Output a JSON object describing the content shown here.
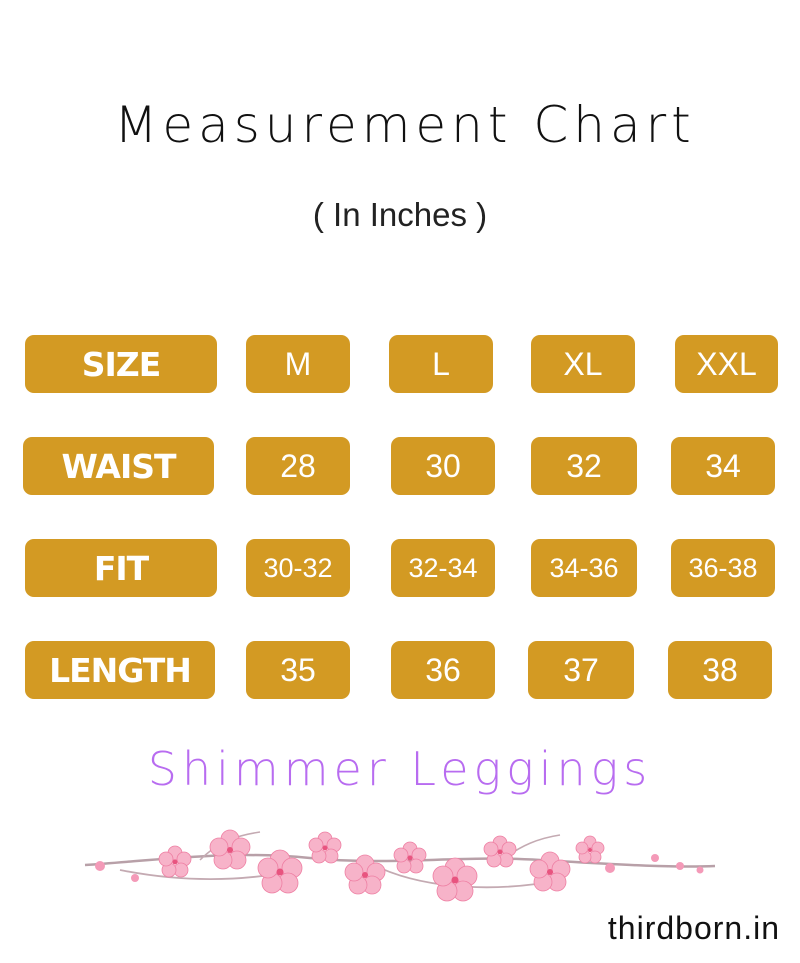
{
  "title": "Measurement Chart",
  "subtitle": "( In Inches )",
  "table": {
    "rows": [
      {
        "label": "SIZE",
        "values": [
          "M",
          "L",
          "XL",
          "XXL"
        ]
      },
      {
        "label": "WAIST",
        "values": [
          "28",
          "30",
          "32",
          "34"
        ]
      },
      {
        "label": "FIT",
        "values": [
          "30-32",
          "32-34",
          "34-36",
          "36-38"
        ]
      },
      {
        "label": "LENGTH",
        "values": [
          "35",
          "36",
          "37",
          "38"
        ]
      }
    ]
  },
  "brand": "Shimmer Leggings",
  "website": "thirdborn.in",
  "colors": {
    "cell_background": "#d39a23",
    "cell_text": "#ffffff",
    "brand_text": "#b86cf0",
    "blossom_pink": "#f49ab8"
  },
  "decoration": "cherry-blossom-branch"
}
